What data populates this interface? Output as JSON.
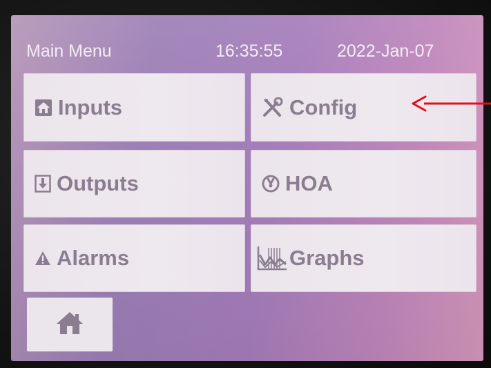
{
  "header": {
    "title": "Main Menu",
    "time": "16:35:55",
    "date": "2022-Jan-07"
  },
  "tiles": [
    {
      "id": "inputs",
      "label": "Inputs",
      "icon": "home-arrow-up-icon"
    },
    {
      "id": "config",
      "label": "Config",
      "icon": "tools-icon"
    },
    {
      "id": "outputs",
      "label": "Outputs",
      "icon": "download-box-icon"
    },
    {
      "id": "hoa",
      "label": "HOA",
      "icon": "gauge-icon"
    },
    {
      "id": "alarms",
      "label": "Alarms",
      "icon": "warning-triangle-icon"
    },
    {
      "id": "graphs",
      "label": "Graphs",
      "icon": "graph-icon"
    }
  ],
  "home_button": {
    "icon": "home-icon"
  },
  "colors": {
    "tile_text": "#8a7d90",
    "header_text": "#f3ecf6",
    "annotation_arrow": "#e0101a"
  }
}
